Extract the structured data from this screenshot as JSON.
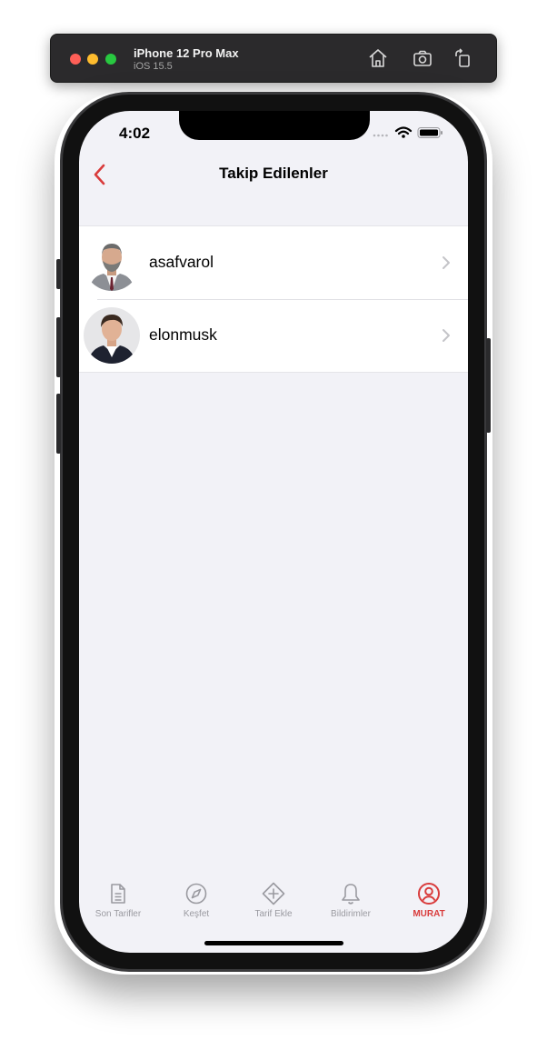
{
  "simulator": {
    "device_name": "iPhone 12 Pro Max",
    "os_version": "iOS 15.5",
    "buttons": [
      "home-icon",
      "screenshot-icon",
      "rotate-icon"
    ]
  },
  "status_bar": {
    "time": "4:02"
  },
  "nav": {
    "title": "Takip Edilenler",
    "back_icon": "chevron-left-icon",
    "accent_color": "#d93c3c"
  },
  "following": [
    {
      "username": "asafvarol",
      "avatar": "person-photo"
    },
    {
      "username": "elonmusk",
      "avatar": "person-photo"
    }
  ],
  "tabs": [
    {
      "label": "Son Tarifler",
      "icon": "document-icon",
      "active": false
    },
    {
      "label": "Keşfet",
      "icon": "compass-icon",
      "active": false
    },
    {
      "label": "Tarif Ekle",
      "icon": "diamond-plus-icon",
      "active": false
    },
    {
      "label": "Bildirimler",
      "icon": "bell-icon",
      "active": false
    },
    {
      "label": "MURAT",
      "icon": "user-circle-icon",
      "active": true
    }
  ]
}
